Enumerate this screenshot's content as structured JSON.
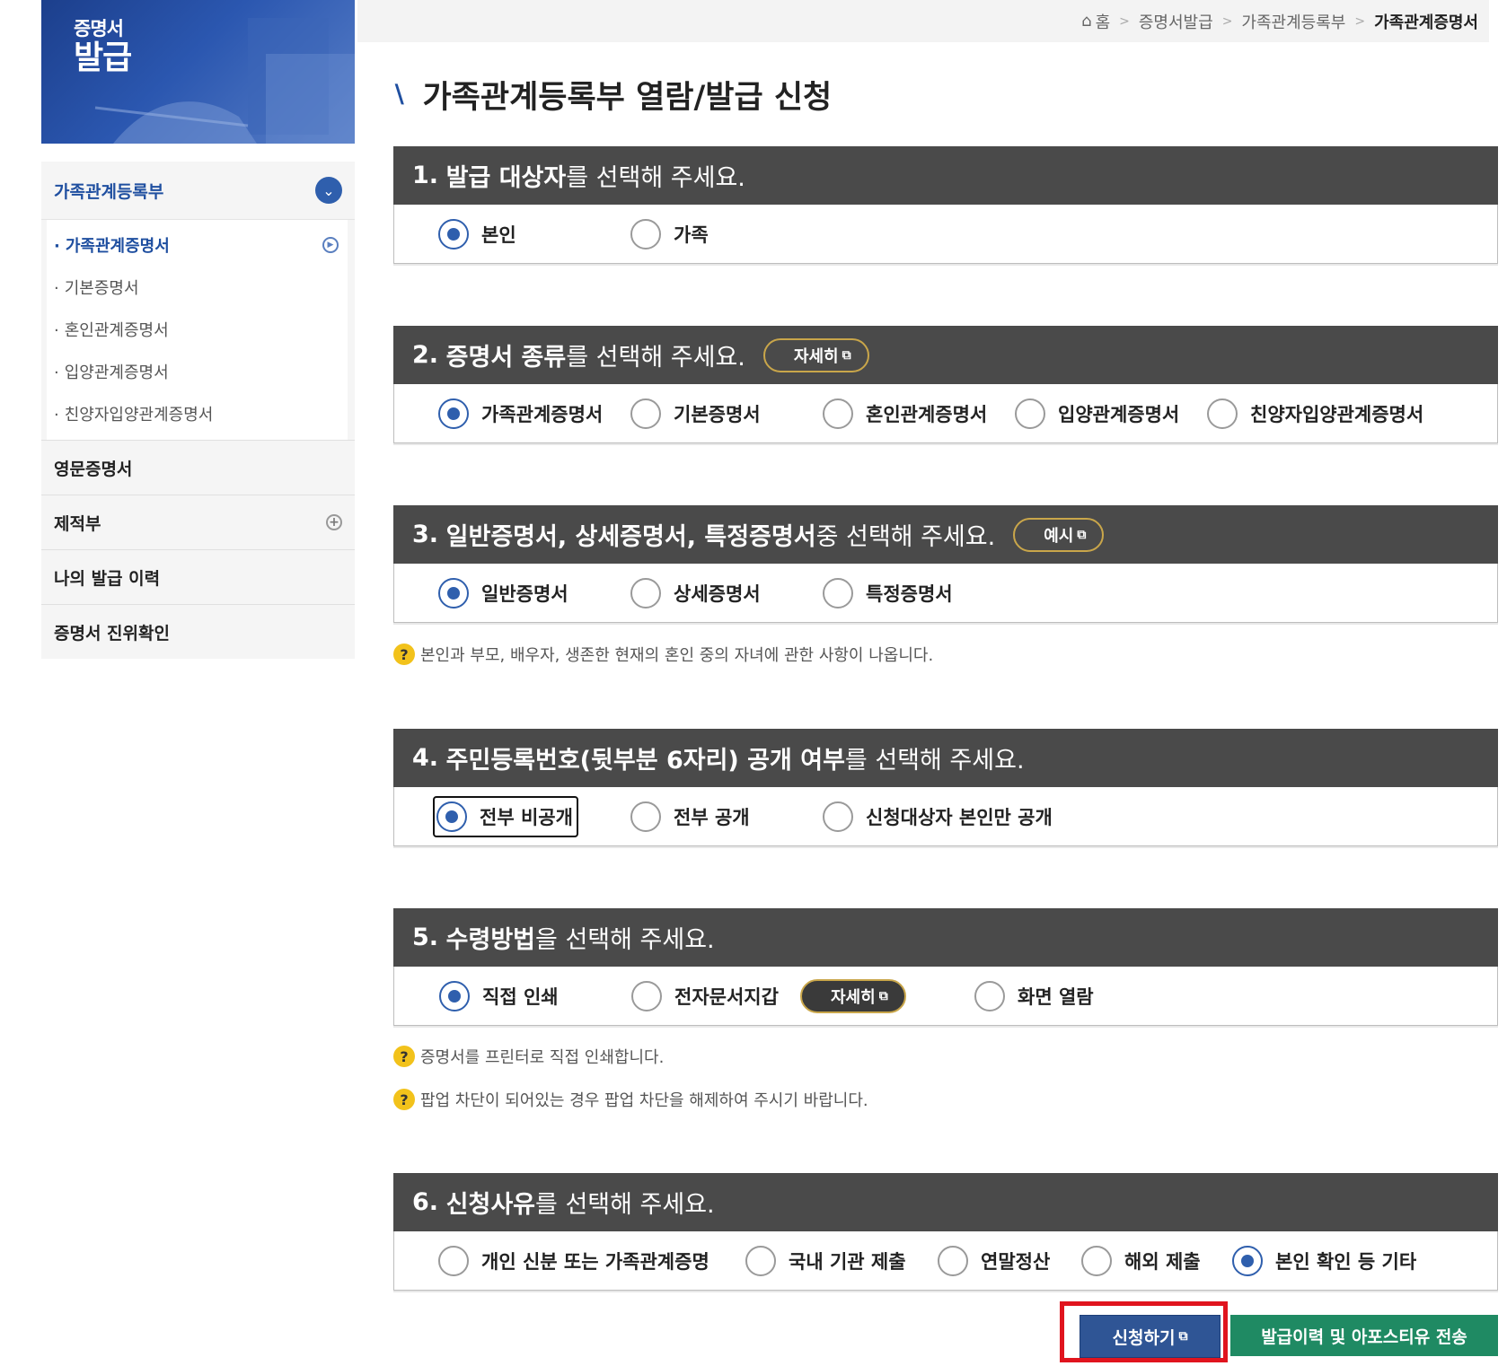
{
  "sidebar": {
    "banner_line1": "증명서",
    "banner_line2": "발급",
    "group": "가족관계등록부",
    "sub_items": [
      "가족관계증명서",
      "기본증명서",
      "혼인관계증명서",
      "입양관계증명서",
      "친양자입양관계증명서"
    ],
    "items": [
      "영문증명서",
      "제적부",
      "나의 발급 이력",
      "증명서 진위확인"
    ]
  },
  "breadcrumb": [
    "홈",
    "증명서발급",
    "가족관계등록부",
    "가족관계증명서"
  ],
  "page_title": "가족관계등록부 열람/발급 신청",
  "sections": {
    "s1": {
      "num": "1.",
      "bold": "발급 대상자",
      "rest": "를 선택해 주세요.",
      "options": [
        "본인",
        "가족"
      ],
      "selected": "본인"
    },
    "s2": {
      "num": "2.",
      "bold": "증명서 종류",
      "rest": "를 선택해 주세요.",
      "pill": "자세히",
      "options": [
        "가족관계증명서",
        "기본증명서",
        "혼인관계증명서",
        "입양관계증명서",
        "친양자입양관계증명서"
      ],
      "selected": "가족관계증명서"
    },
    "s3": {
      "num": "3.",
      "bold": "일반증명서, 상세증명서, 특정증명서",
      "rest": " 중 선택해 주세요.",
      "pill": "예시",
      "options": [
        "일반증명서",
        "상세증명서",
        "특정증명서"
      ],
      "selected": "일반증명서",
      "note": "본인과 부모, 배우자, 생존한 현재의 혼인 중의 자녀에 관한 사항이 나옵니다."
    },
    "s4": {
      "num": "4.",
      "bold": "주민등록번호(뒷부분 6자리) 공개 여부",
      "rest": "를 선택해 주세요.",
      "options": [
        "전부 비공개",
        "전부 공개",
        "신청대상자 본인만 공개"
      ],
      "selected": "전부 비공개"
    },
    "s5": {
      "num": "5.",
      "bold": "수령방법",
      "rest": "을 선택해 주세요.",
      "pill": "자세히",
      "options": [
        "직접 인쇄",
        "전자문서지갑",
        "화면 열람"
      ],
      "selected": "직접 인쇄",
      "notes": [
        "증명서를 프린터로 직접 인쇄합니다.",
        "팝업 차단이 되어있는 경우 팝업 차단을 해제하여 주시기 바랍니다."
      ]
    },
    "s6": {
      "num": "6.",
      "bold": "신청사유",
      "rest": "를 선택해 주세요.",
      "options": [
        "개인 신분 또는 가족관계증명",
        "국내 기관 제출",
        "연말정산",
        "해외 제출",
        "본인 확인 등 기타"
      ],
      "selected": "본인 확인 등 기타"
    }
  },
  "buttons": {
    "apply": "신청하기",
    "send": "발급이력 및 아포스티유 전송"
  },
  "colors": {
    "accent": "#2f5fad",
    "header_bg": "#4a4a4a",
    "send_btn": "#1f8a63",
    "highlight": "#e0141e"
  }
}
